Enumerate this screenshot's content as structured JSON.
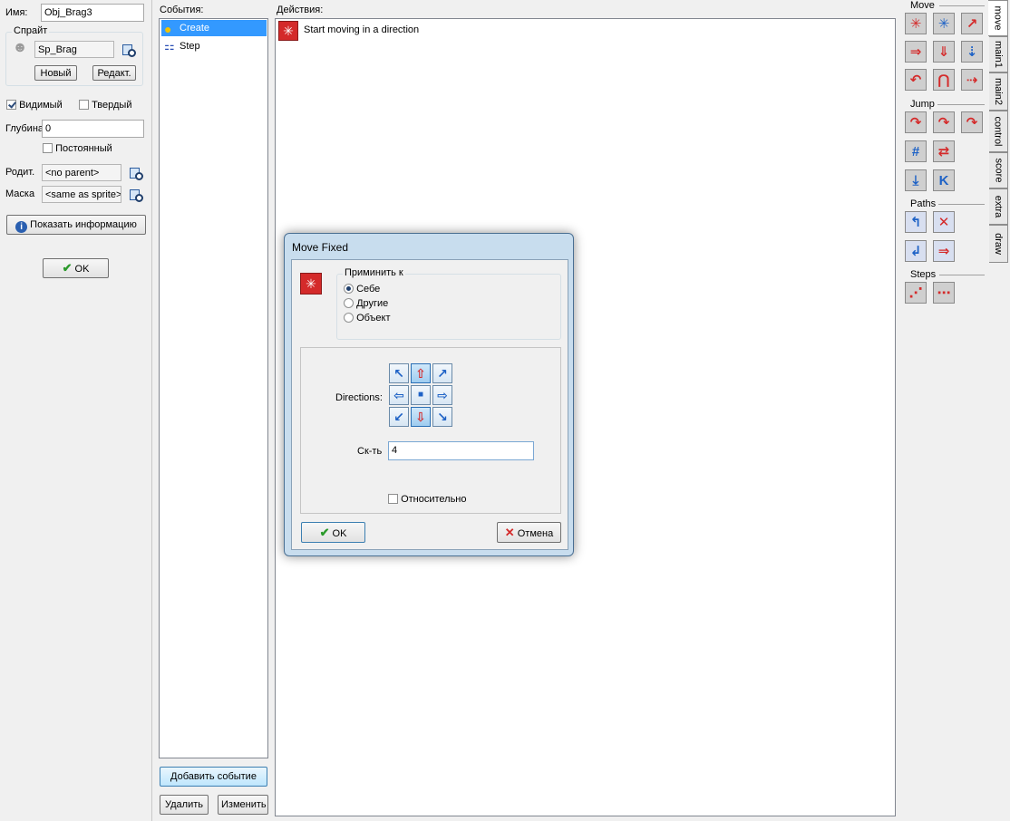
{
  "left_panel": {
    "name_label": "Имя:",
    "name_value": "Obj_Brag3",
    "sprite_group": "Спрайт",
    "sprite_value": "Sp_Brag",
    "new_button": "Новый",
    "edit_button": "Редакт.",
    "visible_label": "Видимый",
    "solid_label": "Твердый",
    "depth_label": "Глубина",
    "depth_value": "0",
    "persistent_label": "Постоянный",
    "parent_label": "Родит.",
    "parent_value": "<no parent>",
    "mask_label": "Маска",
    "mask_value": "<same as sprite>",
    "info_button": "Показать информацию",
    "ok_button": "OK"
  },
  "events": {
    "title": "События:",
    "items": [
      {
        "label": "Create",
        "icon": "lightbulb-icon",
        "selected": true
      },
      {
        "label": "Step",
        "icon": "step-icon",
        "selected": false
      }
    ],
    "add_button": "Добавить событие",
    "delete_button": "Удалить",
    "change_button": "Изменить"
  },
  "actions": {
    "title": "Действия:",
    "items": [
      {
        "label": "Start moving in a direction",
        "icon": "move-fixed-icon"
      }
    ]
  },
  "dialog": {
    "title": "Move Fixed",
    "apply_to_label": "Приминить к",
    "apply_options": [
      "Себе",
      "Другие",
      "Объект"
    ],
    "apply_selected": "Себе",
    "directions_label": "Directions:",
    "speed_label": "Ск-ть",
    "speed_value": "4",
    "relative_label": "Относительно",
    "ok_button": "OK",
    "cancel_button": "Отмена"
  },
  "right_panel": {
    "sections": [
      "Move",
      "Jump",
      "Paths",
      "Steps"
    ],
    "tabs": [
      "move",
      "main1",
      "main2",
      "control",
      "score",
      "extra",
      "draw"
    ],
    "active_tab": "move"
  },
  "colors": {
    "selection": "#3399ff",
    "action_red": "#d42a2a",
    "action_blue": "#1e62c6"
  }
}
